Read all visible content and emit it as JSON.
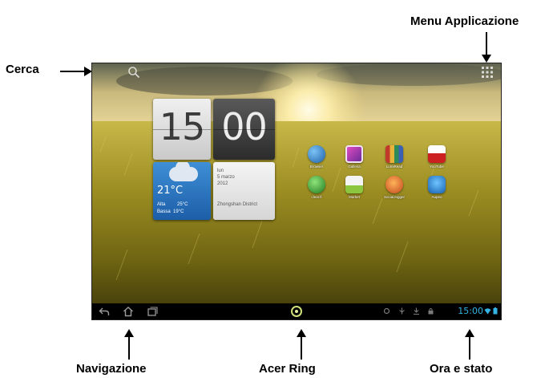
{
  "callouts": {
    "menu_applicazione": "Menu Applicazione",
    "cerca": "Cerca",
    "navigazione": "Navigazione",
    "acer_ring": "Acer Ring",
    "ora_e_stato": "Ora e stato"
  },
  "widgets": {
    "clock": {
      "hours": "15",
      "minutes": "00"
    },
    "weather": {
      "temp": "21°C",
      "alta_label": "Alta",
      "alta_value": "25°C",
      "bassa_label": "Bassa",
      "bassa_value": "19°C"
    },
    "date": {
      "weekday": "lun",
      "day_month": "5 marzo",
      "year": "2012",
      "location": "Zhongshan District"
    }
  },
  "apps": [
    {
      "label": "Browser",
      "icon": "globe-icon",
      "color": "#2a7fc9"
    },
    {
      "label": "Galleria",
      "icon": "gallery-icon",
      "color": "#9b3fb0"
    },
    {
      "label": "LumiRead",
      "icon": "books-icon",
      "color": "#c8a03a"
    },
    {
      "label": "YouTube",
      "icon": "youtube-icon",
      "color": "#d6d6d6"
    },
    {
      "label": "clear.fi",
      "icon": "clearfi-icon",
      "color": "#2fa23a"
    },
    {
      "label": "Market",
      "icon": "market-icon",
      "color": "#e8e8e8"
    },
    {
      "label": "SocialJogger",
      "icon": "socialjogger-icon",
      "color": "#e07b22"
    },
    {
      "label": "Aupeo",
      "icon": "aupeo-icon",
      "color": "#2a88d0"
    }
  ],
  "status_bar": {
    "time": "15:00"
  },
  "colors": {
    "accent_time": "#33b5e5",
    "ring": "#cfe27a"
  }
}
